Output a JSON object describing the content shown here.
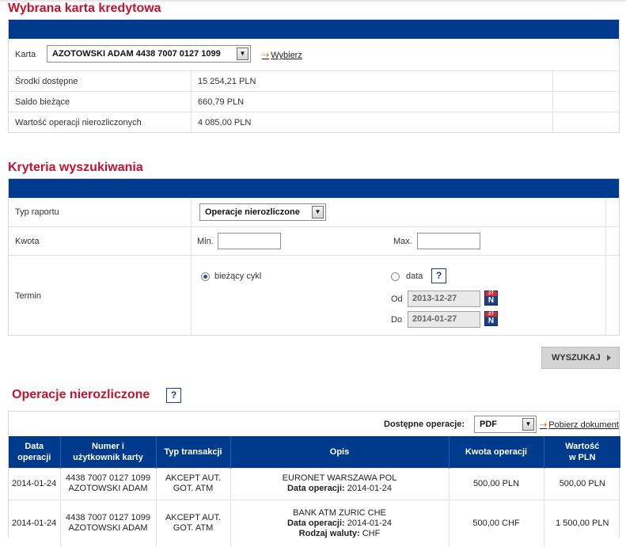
{
  "card_section": {
    "title": "Wybrana karta kredytowa",
    "card_label": "Karta",
    "card_value": "AZOTOWSKI ADAM 4438 7007 0127 1099",
    "choose_link": "Wybierz",
    "rows": [
      {
        "label": "Środki dostępne",
        "value": "15 254,21 PLN"
      },
      {
        "label": "Saldo bieżące",
        "value": "660,79 PLN"
      },
      {
        "label": "Wartość operacji nierozliczonych",
        "value": "4 085,00 PLN"
      }
    ]
  },
  "criteria": {
    "title": "Kryteria wyszukiwania",
    "report_type_label": "Typ raportu",
    "report_type_value": "Operacje nierozliczone",
    "amount_label": "Kwota",
    "min_label": "Min.",
    "max_label": "Max.",
    "min_value": "",
    "max_value": "",
    "term_label": "Termin",
    "current_cycle_label": "bieżący cykl",
    "date_label": "data",
    "help_glyph": "?",
    "from_label": "Od",
    "to_label": "Do",
    "from_value": "2013-12-27",
    "to_value": "2014-01-27",
    "search_button": "WYSZUKAJ"
  },
  "operations": {
    "title": "Operacje nierozliczone",
    "help_glyph": "?",
    "available_ops_label": "Dostępne operacje:",
    "format_value": "PDF",
    "download_link": "Pobierz dokument",
    "columns": [
      "Data operacji",
      "Numer i użytkownik karty",
      "Typ transakcji",
      "Opis",
      "Kwota operacji",
      "Wartość w PLN"
    ],
    "rows": [
      {
        "date": "2014-01-24",
        "card_number": "4438 7007 0127 1099",
        "card_user": "AZOTOWSKI ADAM",
        "type_line1": "AKCEPT AUT.",
        "type_line2": "GOT. ATM",
        "desc_line1": "EURONET WARSZAWA POL",
        "desc_date_label": "Data operacji:",
        "desc_date": "2014-01-24",
        "amount": "500,00 PLN",
        "value_pln": "500,00 PLN"
      },
      {
        "date": "2014-01-24",
        "card_number": "4438 7007 0127 1099",
        "card_user": "AZOTOWSKI ADAM",
        "type_line1": "AKCEPT AUT.",
        "type_line2": "GOT. ATM",
        "desc_line1": "BANK ATM ZURIC CHE",
        "desc_date_label": "Data operacji:",
        "desc_date": "2014-01-24",
        "desc_currency_label": "Rodzaj waluty:",
        "desc_currency": "CHF",
        "amount": "500,00 CHF",
        "value_pln": "1 500,00 PLN"
      }
    ]
  },
  "colors": {
    "accent_red": "#c4122f",
    "header_blue": "#003a8c"
  }
}
